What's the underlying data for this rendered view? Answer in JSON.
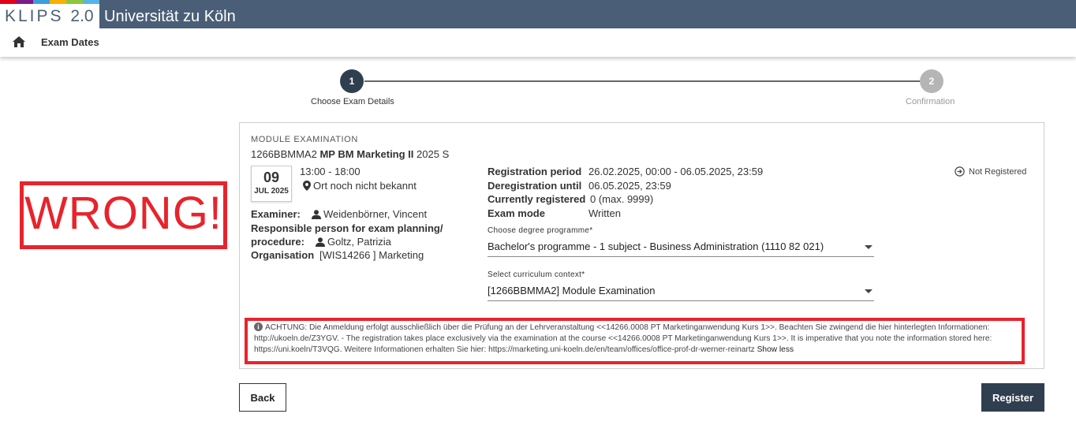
{
  "app": {
    "logo_text": "KLIPS",
    "logo_version": "2.0",
    "university": "Universität zu Köln",
    "logo_stripe_colors": [
      "#e2001a",
      "#7a1a8c",
      "#3aa0dc",
      "#f9b000",
      "#8cc63f",
      "#56b4e9"
    ]
  },
  "breadcrumb": {
    "label": "Exam Dates",
    "home_icon": "home-icon"
  },
  "stepper": {
    "steps": [
      {
        "number": "1",
        "label": "Choose Exam Details"
      },
      {
        "number": "2",
        "label": "Confirmation"
      }
    ],
    "current_step": 1
  },
  "annotation": {
    "text": "WRONG!",
    "color": "#e8232c"
  },
  "exam": {
    "heading": "MODULE EXAMINATION",
    "code": "1266BBMMA2",
    "name": "MP BM Marketing II",
    "term": "2025 S",
    "date_day": "09",
    "date_month": "JUL 2025",
    "time": "13:00 - 18:00",
    "location": "Ort noch nicht bekannt",
    "examiner_label": "Examiner:",
    "examiner": "Weidenbörner, Vincent",
    "responsible_label_1": "Responsible person for exam planning/",
    "responsible_label_2": "procedure:",
    "responsible": "Goltz, Patrizia",
    "organisation_label": "Organisation",
    "organisation": "[WIS14266 ] Marketing",
    "registration_period_label": "Registration period",
    "registration_period": "26.02.2025, 00:00 - 06.05.2025, 23:59",
    "deregistration_label": "Deregistration until",
    "deregistration": "06.05.2025, 23:59",
    "currently_registered_label": "Currently registered",
    "currently_registered": "0 (max. 9999)",
    "exam_mode_label": "Exam mode",
    "exam_mode": "Written",
    "status": "Not Registered"
  },
  "degree_select": {
    "label": "Choose degree programme*",
    "value": "Bachelor's programme - 1 subject - Business Administration (1110 82 021)"
  },
  "curriculum_select": {
    "label": "Select curriculum context*",
    "value": "[1266BBMMA2]  Module Examination"
  },
  "notice": {
    "text": "ACHTUNG: Die Anmeldung erfolgt ausschließlich über die Prüfung an der Lehrveranstaltung <<14266.0008 PT Marketinganwendung Kurs 1>>. Beachten Sie zwingend die hier hinterlegten Informationen: http://ukoeln.de/Z3YGV. - The registration takes place exclusively via the examination at the course <<14266.0008 PT Marketinganwendung Kurs 1>>. It is imperative that you note the information stored here: https://uni.koeln/T3VQG.  Weitere Informationen erhalten Sie hier: https://marketing.uni-koeln.de/en/team/offices/office-prof-dr-werner-reinartz",
    "toggle": "Show less"
  },
  "buttons": {
    "back": "Back",
    "register": "Register"
  },
  "colors": {
    "header": "#4a5f77",
    "primary_button": "#2f3f4f",
    "alert": "#e8232c"
  }
}
